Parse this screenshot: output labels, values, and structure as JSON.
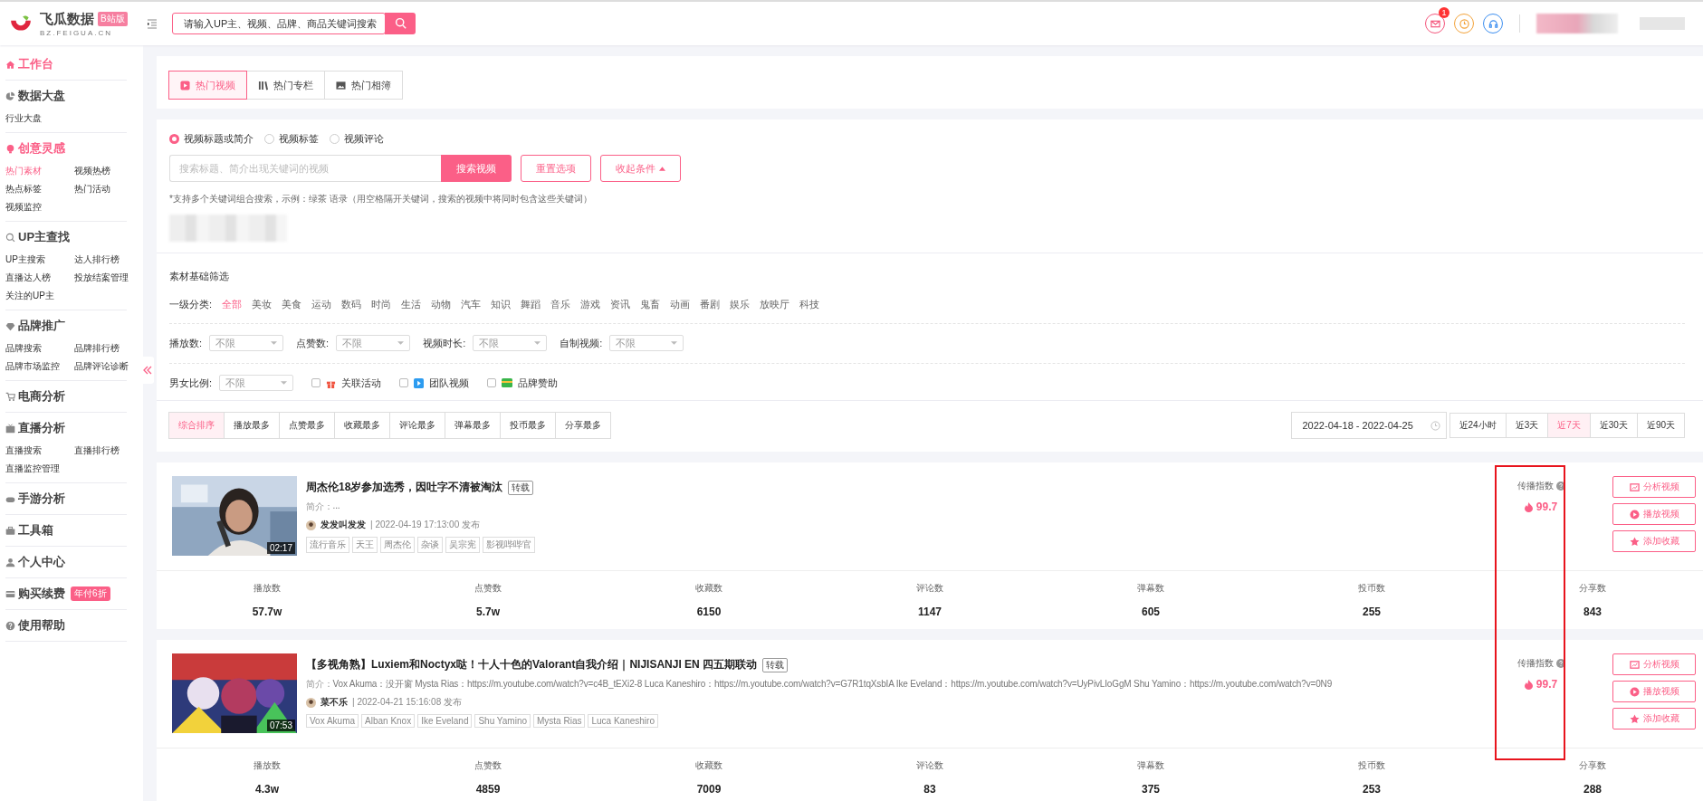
{
  "header": {
    "brand": "飞瓜数据",
    "brand_badge": "B站版",
    "domain": "BZ.FEIGUA.CN",
    "search": {
      "placeholder": "请输入UP主、视频、品牌、商品关键词搜索"
    },
    "mail_count": "1"
  },
  "sidebar": [
    {
      "title": "工作台",
      "active": true
    },
    {
      "title": "数据大盘",
      "active": false,
      "items": [
        {
          "label": "行业大盘",
          "selected": false
        }
      ]
    },
    {
      "title": "创意灵感",
      "active": true,
      "items": [
        {
          "label": "热门素材",
          "selected": true
        },
        {
          "label": "视频热榜",
          "selected": false
        },
        {
          "label": "热点标签",
          "selected": false
        },
        {
          "label": "热门活动",
          "selected": false
        },
        {
          "label": "视频监控",
          "selected": false
        }
      ]
    },
    {
      "title": "UP主查找",
      "active": false,
      "items": [
        {
          "label": "UP主搜索",
          "selected": false
        },
        {
          "label": "达人排行榜",
          "selected": false
        },
        {
          "label": "直播达人榜",
          "selected": false
        },
        {
          "label": "投放结案管理",
          "selected": false
        },
        {
          "label": "关注的UP主",
          "selected": false
        }
      ]
    },
    {
      "title": "品牌推广",
      "active": false,
      "items": [
        {
          "label": "品牌搜索",
          "selected": false
        },
        {
          "label": "品牌排行榜",
          "selected": false
        },
        {
          "label": "品牌市场监控",
          "selected": false
        },
        {
          "label": "品牌评论诊断",
          "selected": false
        }
      ]
    },
    {
      "title": "电商分析",
      "active": false
    },
    {
      "title": "直播分析",
      "active": false,
      "items": [
        {
          "label": "直播搜索",
          "selected": false
        },
        {
          "label": "直播排行榜",
          "selected": false
        },
        {
          "label": "直播监控管理",
          "selected": false
        }
      ]
    },
    {
      "title": "手游分析",
      "active": false
    },
    {
      "title": "工具箱",
      "active": false
    },
    {
      "title": "个人中心",
      "active": false
    },
    {
      "title": "购买续费",
      "active": false,
      "badge": "年付6折"
    },
    {
      "title": "使用帮助",
      "active": false
    }
  ],
  "tabs": [
    {
      "label": "热门视频",
      "selected": true
    },
    {
      "label": "热门专栏",
      "selected": false
    },
    {
      "label": "热门相簿",
      "selected": false
    }
  ],
  "search_scope": [
    {
      "label": "视频标题或简介",
      "selected": true
    },
    {
      "label": "视频标签",
      "selected": false
    },
    {
      "label": "视频评论",
      "selected": false
    }
  ],
  "search": {
    "placeholder": "搜索标题、简介出现关键词的视频",
    "submit": "搜索视频",
    "reset": "重置选项",
    "collapse": "收起条件"
  },
  "hint": "*支持多个关键词组合搜索，示例：绿茶 语录（用空格隔开关键词，搜索的视频中将同时包含这些关键词）",
  "filter_title": "素材基础筛选",
  "category_label": "一级分类:",
  "categories": [
    {
      "label": "全部",
      "selected": true
    },
    {
      "label": "美妆",
      "selected": false
    },
    {
      "label": "美食",
      "selected": false
    },
    {
      "label": "运动",
      "selected": false
    },
    {
      "label": "数码",
      "selected": false
    },
    {
      "label": "时尚",
      "selected": false
    },
    {
      "label": "生活",
      "selected": false
    },
    {
      "label": "动物",
      "selected": false
    },
    {
      "label": "汽车",
      "selected": false
    },
    {
      "label": "知识",
      "selected": false
    },
    {
      "label": "舞蹈",
      "selected": false
    },
    {
      "label": "音乐",
      "selected": false
    },
    {
      "label": "游戏",
      "selected": false
    },
    {
      "label": "资讯",
      "selected": false
    },
    {
      "label": "鬼畜",
      "selected": false
    },
    {
      "label": "动画",
      "selected": false
    },
    {
      "label": "番剧",
      "selected": false
    },
    {
      "label": "娱乐",
      "selected": false
    },
    {
      "label": "放映厅",
      "selected": false
    },
    {
      "label": "科技",
      "selected": false
    }
  ],
  "dropdowns": [
    {
      "label": "播放数:",
      "value": "不限"
    },
    {
      "label": "点赞数:",
      "value": "不限"
    },
    {
      "label": "视频时长:",
      "value": "不限"
    },
    {
      "label": "自制视频:",
      "value": "不限"
    }
  ],
  "gender_dropdown": {
    "label": "男女比例:",
    "value": "不限"
  },
  "checkboxes": [
    {
      "label": "关联活动",
      "checked": false
    },
    {
      "label": "团队视频",
      "checked": false
    },
    {
      "label": "品牌赞助",
      "checked": false
    }
  ],
  "sort_tabs": [
    {
      "label": "综合排序",
      "selected": true
    },
    {
      "label": "播放最多",
      "selected": false
    },
    {
      "label": "点赞最多",
      "selected": false
    },
    {
      "label": "收藏最多",
      "selected": false
    },
    {
      "label": "评论最多",
      "selected": false
    },
    {
      "label": "弹幕最多",
      "selected": false
    },
    {
      "label": "投币最多",
      "selected": false
    },
    {
      "label": "分享最多",
      "selected": false
    }
  ],
  "date_range": "2022-04-18 - 2022-04-25",
  "ranges": [
    {
      "label": "近24小时",
      "selected": false
    },
    {
      "label": "近3天",
      "selected": false
    },
    {
      "label": "近7天",
      "selected": true
    },
    {
      "label": "近30天",
      "selected": false
    },
    {
      "label": "近90天",
      "selected": false
    }
  ],
  "videos": [
    {
      "title": "周杰伦18岁参加选秀，因吐字不清被淘汰",
      "tag": "转载",
      "intro_label": "简介：",
      "intro": "...",
      "author": "发发叫发发",
      "published": "| 2022-04-19 17:13:00 发布",
      "tags": [
        "流行音乐",
        "天王",
        "周杰伦",
        "杂谈",
        "吴宗宪",
        "影视哔哔官"
      ],
      "duration": "02:17",
      "index_label": "传播指数",
      "index": "99.7",
      "actions": [
        "分析视频",
        "播放视频",
        "添加收藏"
      ],
      "stats": [
        {
          "label": "播放数",
          "value": "57.7w"
        },
        {
          "label": "点赞数",
          "value": "5.7w"
        },
        {
          "label": "收藏数",
          "value": "6150"
        },
        {
          "label": "评论数",
          "value": "1147"
        },
        {
          "label": "弹幕数",
          "value": "605"
        },
        {
          "label": "投币数",
          "value": "255"
        },
        {
          "label": "分享数",
          "value": "843"
        }
      ]
    },
    {
      "title": "【多视角熟】Luxiem和Noctyx哒！十人十色的Valorant自我介绍｜NIJISANJI EN 四五期联动",
      "tag": "转载",
      "intro_label": "简介：",
      "intro": "Vox Akuma：没开窗 Mysta Rias：https://m.youtube.com/watch?v=c4B_tEXi2-8 Luca Kaneshiro：https://m.youtube.com/watch?v=G7R1tqXsbIA Ike Eveland：https://m.youtube.com/watch?v=UyPivLIoGgM Shu Yamino：https://m.youtube.com/watch?v=0N9",
      "author": "菜不乐",
      "published": "| 2022-04-21 15:16:08 发布",
      "tags": [
        "Vox Akuma",
        "Alban Knox",
        "Ike Eveland",
        "Shu Yamino",
        "Mysta Rias",
        "Luca Kaneshiro"
      ],
      "duration": "07:53",
      "index_label": "传播指数",
      "index": "99.7",
      "actions": [
        "分析视频",
        "播放视频",
        "添加收藏"
      ],
      "stats": [
        {
          "label": "播放数",
          "value": "4.3w"
        },
        {
          "label": "点赞数",
          "value": "4859"
        },
        {
          "label": "收藏数",
          "value": "7009"
        },
        {
          "label": "评论数",
          "value": "83"
        },
        {
          "label": "弹幕数",
          "value": "375"
        },
        {
          "label": "投币数",
          "value": "253"
        },
        {
          "label": "分享数",
          "value": "288"
        }
      ]
    }
  ]
}
